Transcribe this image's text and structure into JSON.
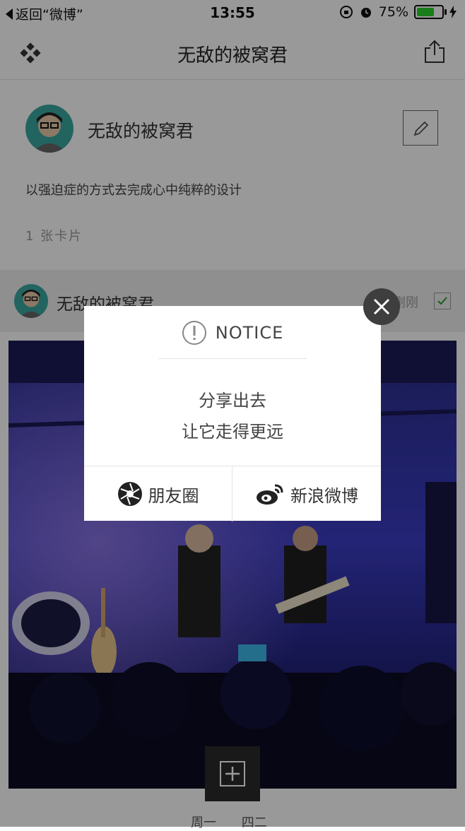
{
  "status_bar": {
    "back_label": "返回“微博”",
    "time": "13:55",
    "battery": "75%",
    "battery_level": 0.75
  },
  "nav": {
    "title": "无敌的被窝君",
    "menu_icon": "four-diamond-icon",
    "share_icon": "share-icon"
  },
  "profile": {
    "name": "无敌的被窝君",
    "bio": "以强迫症的方式去完成心中纯粹的设计",
    "cards_count": "1 张卡片",
    "edit_icon": "pencil-icon"
  },
  "card": {
    "author": "无敌的被窝君",
    "time": "刚刚"
  },
  "bottom": {
    "add_icon": "plus-icon",
    "days": "周一 四二"
  },
  "modal": {
    "title": "NOTICE",
    "line1": "分享出去",
    "line2": "让它走得更远",
    "btn_moments": "朋友圈",
    "btn_weibo": "新浪微博"
  },
  "colors": {
    "battery_green": "#2bd12b",
    "overlay": "rgba(0,0,0,0.40)",
    "close_bg": "#3e3e3e"
  }
}
